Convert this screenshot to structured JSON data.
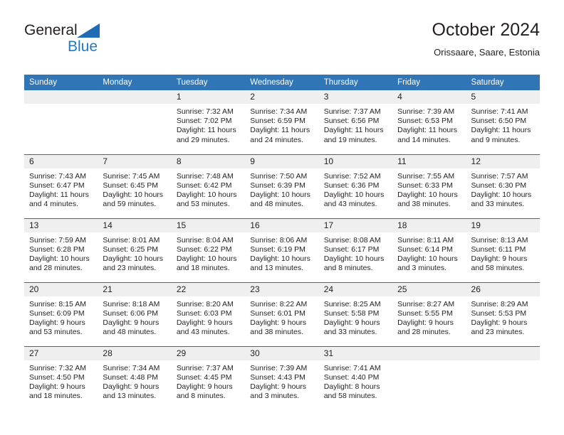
{
  "brand": {
    "line1": "General",
    "line2": "Blue",
    "accent": "#1f7ac4",
    "triangle_color": "#1f6cb4"
  },
  "header": {
    "title": "October 2024",
    "subtitle": "Orissaare, Saare, Estonia"
  },
  "theme": {
    "header_row_bg": "#3075b6",
    "daynum_bg": "#efefef",
    "row_separator": "#2b6cad",
    "text": "#231f20"
  },
  "weekdays": [
    "Sunday",
    "Monday",
    "Tuesday",
    "Wednesday",
    "Thursday",
    "Friday",
    "Saturday"
  ],
  "weeks": [
    [
      {
        "day": "",
        "sunrise": "",
        "sunset": "",
        "daylight": "",
        "empty": true
      },
      {
        "day": "",
        "sunrise": "",
        "sunset": "",
        "daylight": "",
        "empty": true
      },
      {
        "day": "1",
        "sunrise": "Sunrise: 7:32 AM",
        "sunset": "Sunset: 7:02 PM",
        "daylight": "Daylight: 11 hours and 29 minutes."
      },
      {
        "day": "2",
        "sunrise": "Sunrise: 7:34 AM",
        "sunset": "Sunset: 6:59 PM",
        "daylight": "Daylight: 11 hours and 24 minutes."
      },
      {
        "day": "3",
        "sunrise": "Sunrise: 7:37 AM",
        "sunset": "Sunset: 6:56 PM",
        "daylight": "Daylight: 11 hours and 19 minutes."
      },
      {
        "day": "4",
        "sunrise": "Sunrise: 7:39 AM",
        "sunset": "Sunset: 6:53 PM",
        "daylight": "Daylight: 11 hours and 14 minutes."
      },
      {
        "day": "5",
        "sunrise": "Sunrise: 7:41 AM",
        "sunset": "Sunset: 6:50 PM",
        "daylight": "Daylight: 11 hours and 9 minutes."
      }
    ],
    [
      {
        "day": "6",
        "sunrise": "Sunrise: 7:43 AM",
        "sunset": "Sunset: 6:47 PM",
        "daylight": "Daylight: 11 hours and 4 minutes."
      },
      {
        "day": "7",
        "sunrise": "Sunrise: 7:45 AM",
        "sunset": "Sunset: 6:45 PM",
        "daylight": "Daylight: 10 hours and 59 minutes."
      },
      {
        "day": "8",
        "sunrise": "Sunrise: 7:48 AM",
        "sunset": "Sunset: 6:42 PM",
        "daylight": "Daylight: 10 hours and 53 minutes."
      },
      {
        "day": "9",
        "sunrise": "Sunrise: 7:50 AM",
        "sunset": "Sunset: 6:39 PM",
        "daylight": "Daylight: 10 hours and 48 minutes."
      },
      {
        "day": "10",
        "sunrise": "Sunrise: 7:52 AM",
        "sunset": "Sunset: 6:36 PM",
        "daylight": "Daylight: 10 hours and 43 minutes."
      },
      {
        "day": "11",
        "sunrise": "Sunrise: 7:55 AM",
        "sunset": "Sunset: 6:33 PM",
        "daylight": "Daylight: 10 hours and 38 minutes."
      },
      {
        "day": "12",
        "sunrise": "Sunrise: 7:57 AM",
        "sunset": "Sunset: 6:30 PM",
        "daylight": "Daylight: 10 hours and 33 minutes."
      }
    ],
    [
      {
        "day": "13",
        "sunrise": "Sunrise: 7:59 AM",
        "sunset": "Sunset: 6:28 PM",
        "daylight": "Daylight: 10 hours and 28 minutes."
      },
      {
        "day": "14",
        "sunrise": "Sunrise: 8:01 AM",
        "sunset": "Sunset: 6:25 PM",
        "daylight": "Daylight: 10 hours and 23 minutes."
      },
      {
        "day": "15",
        "sunrise": "Sunrise: 8:04 AM",
        "sunset": "Sunset: 6:22 PM",
        "daylight": "Daylight: 10 hours and 18 minutes."
      },
      {
        "day": "16",
        "sunrise": "Sunrise: 8:06 AM",
        "sunset": "Sunset: 6:19 PM",
        "daylight": "Daylight: 10 hours and 13 minutes."
      },
      {
        "day": "17",
        "sunrise": "Sunrise: 8:08 AM",
        "sunset": "Sunset: 6:17 PM",
        "daylight": "Daylight: 10 hours and 8 minutes."
      },
      {
        "day": "18",
        "sunrise": "Sunrise: 8:11 AM",
        "sunset": "Sunset: 6:14 PM",
        "daylight": "Daylight: 10 hours and 3 minutes."
      },
      {
        "day": "19",
        "sunrise": "Sunrise: 8:13 AM",
        "sunset": "Sunset: 6:11 PM",
        "daylight": "Daylight: 9 hours and 58 minutes."
      }
    ],
    [
      {
        "day": "20",
        "sunrise": "Sunrise: 8:15 AM",
        "sunset": "Sunset: 6:09 PM",
        "daylight": "Daylight: 9 hours and 53 minutes."
      },
      {
        "day": "21",
        "sunrise": "Sunrise: 8:18 AM",
        "sunset": "Sunset: 6:06 PM",
        "daylight": "Daylight: 9 hours and 48 minutes."
      },
      {
        "day": "22",
        "sunrise": "Sunrise: 8:20 AM",
        "sunset": "Sunset: 6:03 PM",
        "daylight": "Daylight: 9 hours and 43 minutes."
      },
      {
        "day": "23",
        "sunrise": "Sunrise: 8:22 AM",
        "sunset": "Sunset: 6:01 PM",
        "daylight": "Daylight: 9 hours and 38 minutes."
      },
      {
        "day": "24",
        "sunrise": "Sunrise: 8:25 AM",
        "sunset": "Sunset: 5:58 PM",
        "daylight": "Daylight: 9 hours and 33 minutes."
      },
      {
        "day": "25",
        "sunrise": "Sunrise: 8:27 AM",
        "sunset": "Sunset: 5:55 PM",
        "daylight": "Daylight: 9 hours and 28 minutes."
      },
      {
        "day": "26",
        "sunrise": "Sunrise: 8:29 AM",
        "sunset": "Sunset: 5:53 PM",
        "daylight": "Daylight: 9 hours and 23 minutes."
      }
    ],
    [
      {
        "day": "27",
        "sunrise": "Sunrise: 7:32 AM",
        "sunset": "Sunset: 4:50 PM",
        "daylight": "Daylight: 9 hours and 18 minutes."
      },
      {
        "day": "28",
        "sunrise": "Sunrise: 7:34 AM",
        "sunset": "Sunset: 4:48 PM",
        "daylight": "Daylight: 9 hours and 13 minutes."
      },
      {
        "day": "29",
        "sunrise": "Sunrise: 7:37 AM",
        "sunset": "Sunset: 4:45 PM",
        "daylight": "Daylight: 9 hours and 8 minutes."
      },
      {
        "day": "30",
        "sunrise": "Sunrise: 7:39 AM",
        "sunset": "Sunset: 4:43 PM",
        "daylight": "Daylight: 9 hours and 3 minutes."
      },
      {
        "day": "31",
        "sunrise": "Sunrise: 7:41 AM",
        "sunset": "Sunset: 4:40 PM",
        "daylight": "Daylight: 8 hours and 58 minutes."
      },
      {
        "day": "",
        "sunrise": "",
        "sunset": "",
        "daylight": "",
        "empty": true
      },
      {
        "day": "",
        "sunrise": "",
        "sunset": "",
        "daylight": "",
        "empty": true
      }
    ]
  ]
}
